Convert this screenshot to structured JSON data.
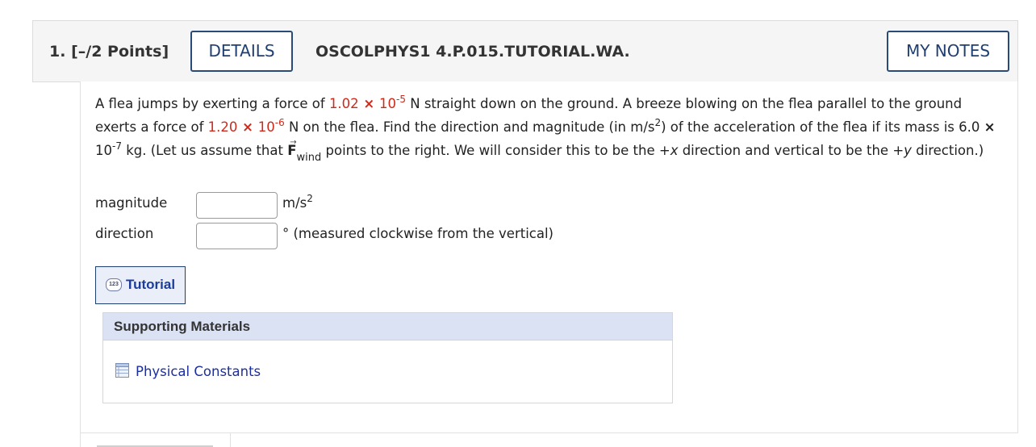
{
  "header": {
    "question_number": "1.",
    "points": "[–/2 Points]",
    "details_label": "DETAILS",
    "assignment_code": "OSCOLPHYS1 4.P.015.TUTORIAL.WA.",
    "my_notes_label": "MY NOTES"
  },
  "problem": {
    "part1": "A flea jumps by exerting a force of ",
    "force1_mantissa": "1.02",
    "force1_times": " × ",
    "force1_base": "10",
    "force1_exp": "-5",
    "part2": " N straight down on the ground. A breeze blowing on the flea parallel to the ground exerts a force of ",
    "force2_mantissa": "1.20",
    "force2_times": " × ",
    "force2_base": "10",
    "force2_exp": "-6",
    "part3": " N on the flea. Find the direction and magnitude (in m/s",
    "part3_sup": "2",
    "part4": ") of the acceleration of the flea if its mass is 6.0 ",
    "mass_times": "×",
    "mass_base": " 10",
    "mass_exp": "-7",
    "part5": " kg. (Let us assume that ",
    "vector_symbol": "F",
    "vector_sub": "wind",
    "part6": " points to the right. We will consider this to be the +",
    "x_italic": "x",
    "part7": " direction and vertical to be the +",
    "y_italic": "y",
    "part8": " direction.)"
  },
  "answers": {
    "magnitude_label": "magnitude",
    "magnitude_value": "",
    "magnitude_unit": "m/s",
    "magnitude_unit_sup": "2",
    "direction_label": "direction",
    "direction_value": "",
    "direction_unit": "° (measured clockwise from the vertical)"
  },
  "tutorial": {
    "icon_text": "123",
    "label": "Tutorial"
  },
  "supporting": {
    "header": "Supporting Materials",
    "link_label": "Physical Constants"
  },
  "colors": {
    "given_value_red": "#cc2b1c",
    "button_border": "#2a4a7a",
    "link_blue": "#1c2f9c",
    "support_header_bg": "#dbe2f4"
  }
}
